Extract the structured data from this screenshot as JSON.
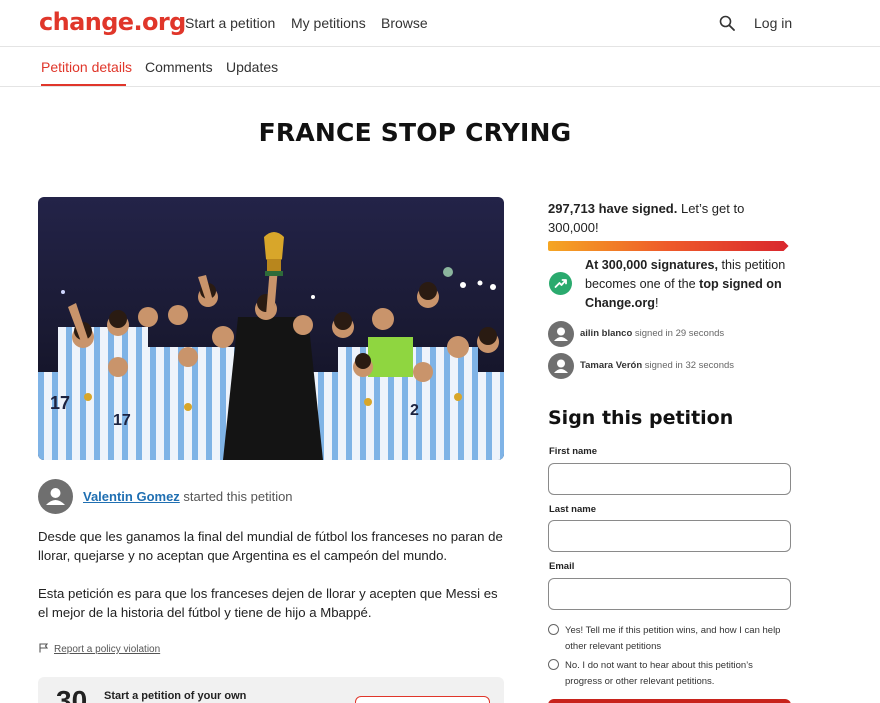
{
  "header": {
    "logo": "change.org",
    "nav": [
      "Start a petition",
      "My petitions",
      "Browse"
    ],
    "login": "Log in"
  },
  "tabs": [
    "Petition details",
    "Comments",
    "Updates"
  ],
  "petition": {
    "title": "FRANCE STOP CRYING",
    "starter_name": "Valentin Gomez",
    "starter_suffix": " started this petition",
    "paragraphs": [
      "Desde que les ganamos la final del mundial de fútbol los franceses no paran de llorar, quejarse y no aceptan que Argentina es el campeón del mundo.",
      "Esta petición es para que los franceses dejen de llorar y acepten que Messi es el mejor de la historia del fútbol y tiene de hijo a Mbappé."
    ],
    "report": "Report a policy violation",
    "start_card": {
      "number": "30",
      "text": "Start a petition of your own"
    }
  },
  "signatures": {
    "count": "297,713 have signed.",
    "goal_text": " Let’s get to 300,000!",
    "progress_fraction": 0.99,
    "milestone": {
      "bold1": "At 300,000 signatures,",
      "text1": " this petition becomes one of the ",
      "bold2": "top signed on Change.org",
      "text2": "!"
    },
    "recent": [
      {
        "name": "ailin blanco",
        "time": " signed in 29 seconds"
      },
      {
        "name": "Tamara Verón",
        "time": " signed in 32 seconds"
      }
    ]
  },
  "form": {
    "heading": "Sign this petition",
    "first_name_label": "First name",
    "last_name_label": "Last name",
    "email_label": "Email",
    "first_name_value": "",
    "last_name_value": "",
    "email_value": "",
    "opt_in": "Yes! Tell me if this petition wins, and how I can help other relevant petitions",
    "opt_out": "No. I do not want to hear about this petition’s progress or other relevant petitions."
  },
  "colors": {
    "brand": "#e0362a",
    "link": "#1f6fb2",
    "milestone_green": "#2aaa6e"
  },
  "icons": [
    "search-icon",
    "trending-up-icon",
    "user-avatar-icon",
    "flag-icon"
  ]
}
